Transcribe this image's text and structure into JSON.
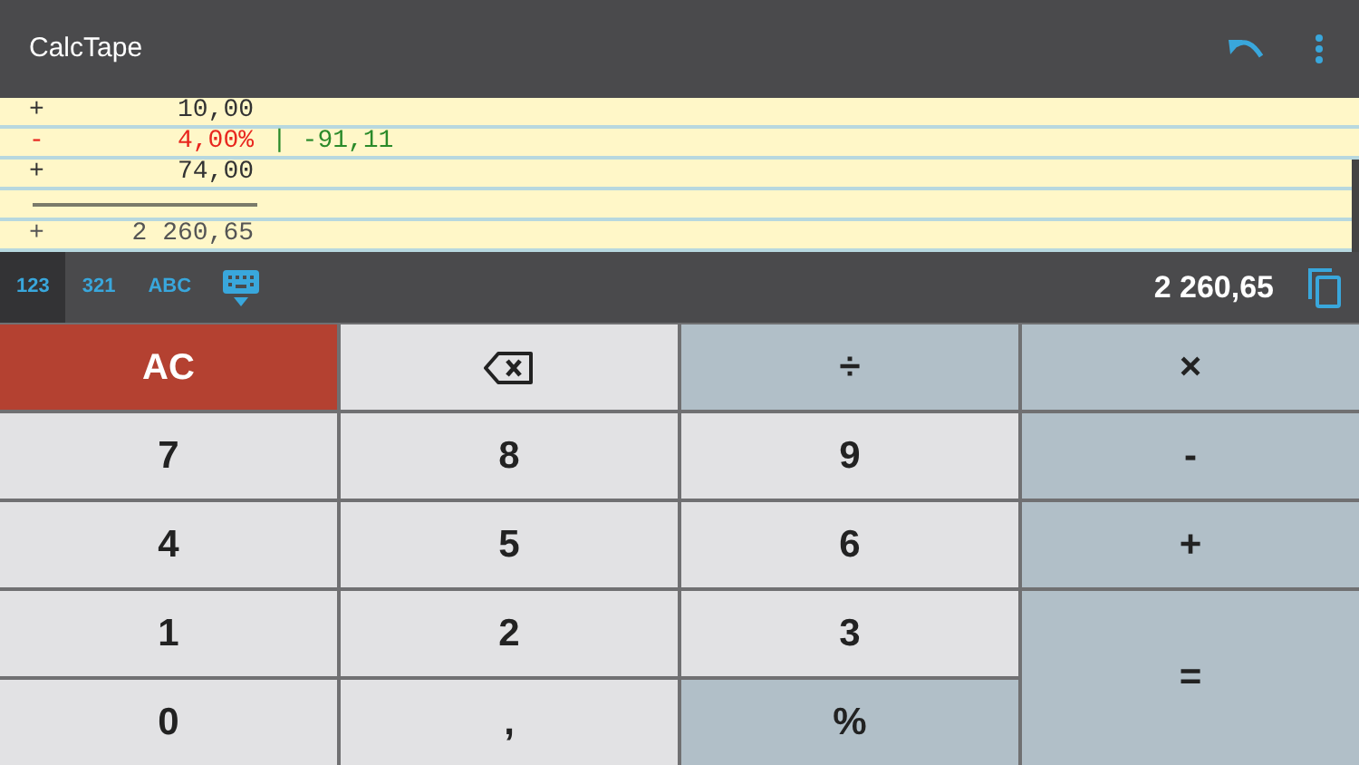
{
  "app_bar": {
    "title": "CalcTape"
  },
  "tape": {
    "rows": [
      {
        "kind": "entry",
        "op": "+",
        "value": "10,00",
        "color": "#333333"
      },
      {
        "kind": "entry",
        "op": "-",
        "value": "4,00%",
        "color": "#e8261e",
        "note": "| -91,11"
      },
      {
        "kind": "entry",
        "op": "+",
        "value": "74,00",
        "color": "#333333"
      },
      {
        "kind": "rule"
      },
      {
        "kind": "entry",
        "op": "+",
        "value": "2 260,65",
        "color": "#555555"
      }
    ]
  },
  "toolbar": {
    "modes": [
      {
        "label": "123",
        "selected": true
      },
      {
        "label": "321",
        "selected": false
      },
      {
        "label": "ABC",
        "selected": false
      }
    ],
    "result": "2 260,65"
  },
  "keys": [
    {
      "label": "AC",
      "kind": "clear"
    },
    {
      "kind": "backspace"
    },
    {
      "label": "÷",
      "kind": "op"
    },
    {
      "label": "×",
      "kind": "op"
    },
    {
      "label": "7",
      "kind": "digit"
    },
    {
      "label": "8",
      "kind": "digit"
    },
    {
      "label": "9",
      "kind": "digit"
    },
    {
      "label": "-",
      "kind": "op"
    },
    {
      "label": "4",
      "kind": "digit"
    },
    {
      "label": "5",
      "kind": "digit"
    },
    {
      "label": "6",
      "kind": "digit"
    },
    {
      "label": "+",
      "kind": "op"
    },
    {
      "label": "1",
      "kind": "digit"
    },
    {
      "label": "2",
      "kind": "digit"
    },
    {
      "label": "3",
      "kind": "digit"
    },
    {
      "label": "=",
      "kind": "equals"
    },
    {
      "label": "0",
      "kind": "digit"
    },
    {
      "label": ",",
      "kind": "digit"
    },
    {
      "label": "%",
      "kind": "op"
    }
  ]
}
